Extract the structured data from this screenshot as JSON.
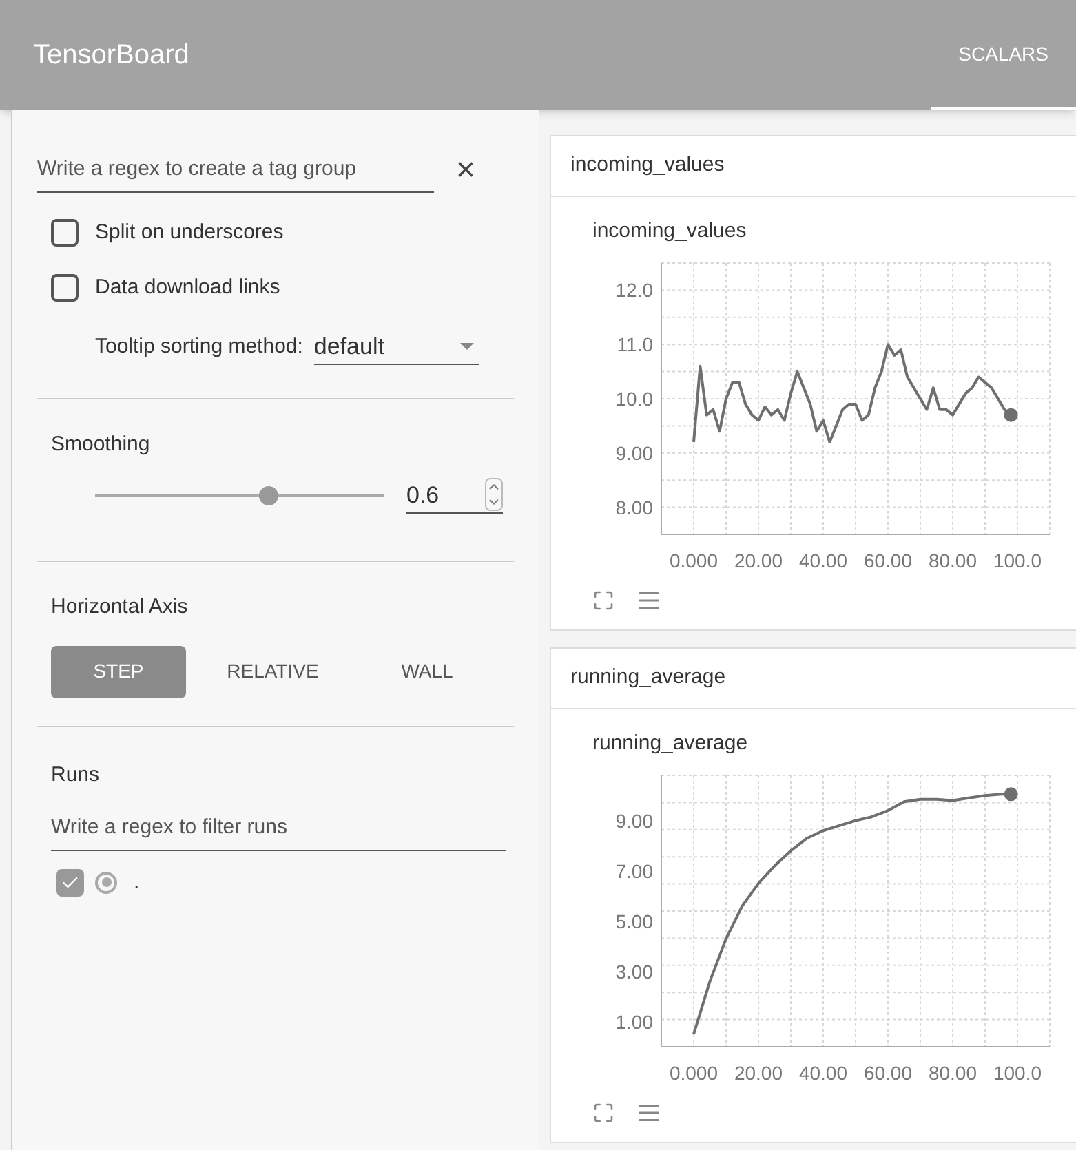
{
  "app": {
    "title": "TensorBoard"
  },
  "tabs": [
    {
      "label": "SCALARS",
      "selected": true
    }
  ],
  "sidebar": {
    "tag_filter": {
      "placeholder": "Write a regex to create a tag group",
      "clear": "×"
    },
    "options": [
      {
        "label": "Split on underscores",
        "checked": false
      },
      {
        "label": "Data download links",
        "checked": false
      }
    ],
    "tooltip_sorting": {
      "label": "Tooltip sorting method:",
      "value": "default"
    },
    "smoothing": {
      "label": "Smoothing",
      "level": 0.6,
      "value": "0.6"
    },
    "horizontal_axis": {
      "label": "Horizontal Axis",
      "options": [
        {
          "label": "STEP",
          "selected": true
        },
        {
          "label": "RELATIVE",
          "selected": false
        },
        {
          "label": "WALL",
          "selected": false
        }
      ]
    },
    "runs": {
      "label": "Runs",
      "placeholder": "Write a regex to filter runs",
      "items": [
        {
          "label": ".",
          "checked": true,
          "selected": true
        }
      ]
    }
  },
  "cards": [
    {
      "title": "incoming_values",
      "chart_data": {
        "type": "line",
        "title": "incoming_values",
        "x": [
          0,
          2,
          4,
          6,
          8,
          10,
          12,
          14,
          16,
          18,
          20,
          22,
          24,
          26,
          28,
          30,
          32,
          34,
          36,
          38,
          40,
          42,
          44,
          46,
          48,
          50,
          52,
          54,
          56,
          58,
          60,
          62,
          64,
          66,
          68,
          70,
          72,
          74,
          76,
          78,
          80,
          82,
          84,
          86,
          88,
          90,
          92,
          94,
          96,
          98
        ],
        "series": [
          {
            "color": "#6f6f6f",
            "values": [
              9.2,
              10.6,
              9.7,
              9.8,
              9.4,
              10.0,
              10.3,
              10.3,
              9.9,
              9.7,
              9.6,
              9.85,
              9.7,
              9.8,
              9.6,
              10.1,
              10.5,
              10.2,
              9.9,
              9.4,
              9.6,
              9.2,
              9.5,
              9.8,
              9.9,
              9.9,
              9.6,
              9.7,
              10.2,
              10.5,
              11.0,
              10.8,
              10.9,
              10.4,
              10.2,
              10.0,
              9.8,
              10.2,
              9.8,
              9.8,
              9.7,
              9.9,
              10.1,
              10.2,
              10.4,
              10.3,
              10.2,
              10.0,
              9.8,
              9.7
            ]
          }
        ],
        "xlim": [
          -10,
          110
        ],
        "ylim": [
          7.5,
          12.5
        ],
        "grid": true,
        "xticks": [
          {
            "value": 0,
            "label": "0.000"
          },
          {
            "value": 20,
            "label": "20.00"
          },
          {
            "value": 40,
            "label": "40.00"
          },
          {
            "value": 60,
            "label": "60.00"
          },
          {
            "value": 80,
            "label": "80.00"
          },
          {
            "value": 100,
            "label": "100.0"
          }
        ],
        "yticks": [
          {
            "value": 8,
            "label": "8.00"
          },
          {
            "value": 9,
            "label": "9.00"
          },
          {
            "value": 10,
            "label": "10.0"
          },
          {
            "value": 11,
            "label": "11.0"
          },
          {
            "value": 12,
            "label": "12.0"
          }
        ]
      }
    },
    {
      "title": "running_average",
      "chart_data": {
        "type": "line",
        "title": "running_average",
        "x": [
          0,
          5,
          10,
          15,
          20,
          25,
          30,
          35,
          40,
          45,
          50,
          55,
          60,
          65,
          70,
          75,
          80,
          85,
          90,
          95,
          98
        ],
        "series": [
          {
            "color": "#6f6f6f",
            "values": [
              0.5,
              2.6,
              4.3,
              5.6,
              6.5,
              7.2,
              7.8,
              8.3,
              8.6,
              8.8,
              9.0,
              9.15,
              9.4,
              9.75,
              9.85,
              9.85,
              9.8,
              9.9,
              10.0,
              10.05,
              10.05
            ]
          }
        ],
        "xlim": [
          -10,
          110
        ],
        "ylim": [
          0,
          10.8
        ],
        "grid": true,
        "xticks": [
          {
            "value": 0,
            "label": "0.000"
          },
          {
            "value": 20,
            "label": "20.00"
          },
          {
            "value": 40,
            "label": "40.00"
          },
          {
            "value": 60,
            "label": "60.00"
          },
          {
            "value": 80,
            "label": "80.00"
          },
          {
            "value": 100,
            "label": "100.0"
          }
        ],
        "yticks": [
          {
            "value": 1,
            "label": "1.00"
          },
          {
            "value": 3,
            "label": "3.00"
          },
          {
            "value": 5,
            "label": "5.00"
          },
          {
            "value": 7,
            "label": "7.00"
          },
          {
            "value": 9,
            "label": "9.00"
          }
        ]
      }
    }
  ]
}
